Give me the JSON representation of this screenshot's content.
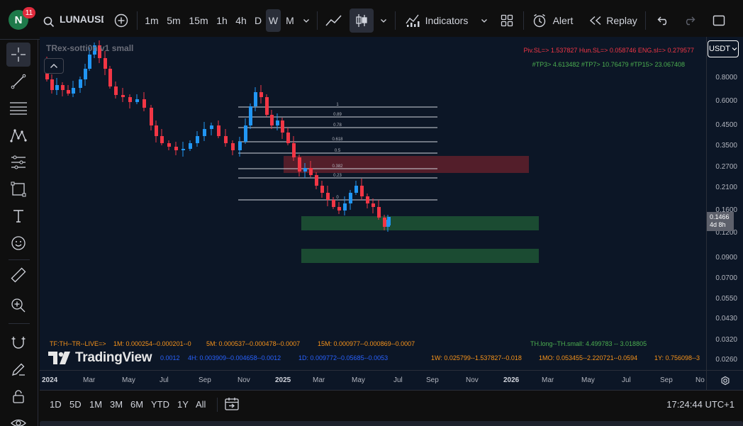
{
  "topbar": {
    "avatar_letter": "N",
    "notification_count": "11",
    "symbol": "LUNAUSD",
    "timeframes": [
      "1m",
      "5m",
      "15m",
      "1h",
      "4h",
      "D",
      "W",
      "M"
    ],
    "active_timeframe": "W",
    "indicators_label": "Indicators",
    "alert_label": "Alert",
    "replay_label": "Replay"
  },
  "chart": {
    "indicator_name": "TRex-sotti0n v1 small",
    "stops_line": "Piv.SL=> 1.537827  Hun.SL=> 0.058746  ENG.sl=> 0.279577",
    "targets_line": "#TP3> 4.613482  #TP7> 10.76479  #TP15> 23.067408",
    "fib_labels": [
      "1",
      "0.89",
      "0.78",
      "0.618",
      "0.5",
      "0.382",
      "0.23",
      "0"
    ],
    "table": {
      "row1_prefix": "TF:TH--TR--LIVE=>",
      "tf_1m": "1M: 0.000254--0.000201--0",
      "tf_5m": "5M: 0.000537--0.000478--0.0007",
      "tf_15m": "15M: 0.000977--0.000869--0.0007",
      "th_long_small": "TH.long--TH.small: 4.499783 -- 3.018805",
      "tf_1h_tail": "0.0012",
      "tf_4h": "4H: 0.003909--0.004658--0.0012",
      "tf_1d": "1D: 0.009772--0.05685--0.0053",
      "tf_1w": "1W: 0.025799--1.537827--0.018",
      "tf_1mo": "1MO: 0.053455--2.220721--0.0594",
      "tf_1y": "1Y: 0.756098--3"
    },
    "logo_text": "TradingView"
  },
  "price_axis": {
    "currency": "USDT",
    "ticks": [
      "0.8000",
      "0.6000",
      "0.4500",
      "0.3500",
      "0.2700",
      "0.2100",
      "0.1600",
      "0.1200",
      "0.0900",
      "0.0700",
      "0.0550",
      "0.0430",
      "0.0320",
      "0.0260"
    ],
    "current_price": "0.1466",
    "countdown": "4d 8h"
  },
  "time_axis": {
    "labels": [
      "2024",
      "Mar",
      "May",
      "Jul",
      "Sep",
      "Nov",
      "2025",
      "Mar",
      "May",
      "Jul",
      "Sep",
      "Nov",
      "2026",
      "Mar",
      "May",
      "Jul",
      "Sep",
      "No"
    ]
  },
  "bottombar": {
    "ranges": [
      "1D",
      "5D",
      "1M",
      "3M",
      "6M",
      "YTD",
      "1Y",
      "All"
    ],
    "clock": "17:24:44 UTC+1"
  },
  "colors": {
    "up": "#2196f3",
    "down": "#f23645",
    "supply_zone": "#5b1f2b",
    "demand_zone": "#1b4b32",
    "chart_bg": "#0c1626"
  }
}
